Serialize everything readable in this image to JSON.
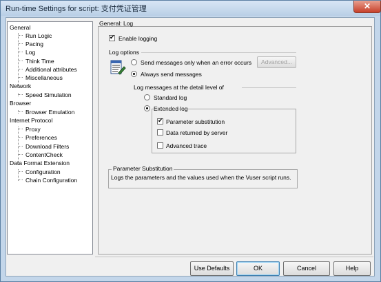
{
  "window": {
    "title": "Run-time Settings for script: 支付凭证管理",
    "close_glyph": "✕"
  },
  "tree": {
    "items": [
      {
        "label": "General",
        "level": 0
      },
      {
        "label": "Run Logic",
        "level": 1
      },
      {
        "label": "Pacing",
        "level": 1
      },
      {
        "label": "Log",
        "level": 1
      },
      {
        "label": "Think Time",
        "level": 1
      },
      {
        "label": "Additional attributes",
        "level": 1
      },
      {
        "label": "Miscellaneous",
        "level": 1
      },
      {
        "label": "Network",
        "level": 0
      },
      {
        "label": "Speed Simulation",
        "level": 1
      },
      {
        "label": "Browser",
        "level": 0
      },
      {
        "label": "Browser Emulation",
        "level": 1
      },
      {
        "label": "Internet Protocol",
        "level": 0
      },
      {
        "label": "Proxy",
        "level": 1
      },
      {
        "label": "Preferences",
        "level": 1
      },
      {
        "label": "Download Filters",
        "level": 1
      },
      {
        "label": "ContentCheck",
        "level": 1
      },
      {
        "label": "Data Format Extension",
        "level": 0
      },
      {
        "label": "Configuration",
        "level": 1
      },
      {
        "label": "Chain Configuration",
        "level": 1
      }
    ]
  },
  "panel": {
    "header": "General: Log",
    "enable_logging": {
      "label": "Enable logging",
      "checked": true
    },
    "log_options": {
      "label": "Log options",
      "errors_only": {
        "label": "Send messages only when an error occurs",
        "selected": false
      },
      "always": {
        "label": "Always send messages",
        "selected": true
      },
      "advanced_button": "Advanced..."
    },
    "detail_level": {
      "label": "Log messages at the detail level of",
      "standard": {
        "label": "Standard log",
        "selected": false
      },
      "extended": {
        "label": "Extended log",
        "selected": true
      },
      "options": [
        {
          "label": "Parameter substitution",
          "checked": true
        },
        {
          "label": "Data returned by server",
          "checked": false
        },
        {
          "label": "Advanced trace",
          "checked": false
        }
      ]
    },
    "description": {
      "title": "Parameter Substitution",
      "text": "Logs the parameters and the values used when the Vuser script runs."
    }
  },
  "buttons": {
    "use_defaults": "Use Defaults",
    "ok": "OK",
    "cancel": "Cancel",
    "help": "Help"
  }
}
